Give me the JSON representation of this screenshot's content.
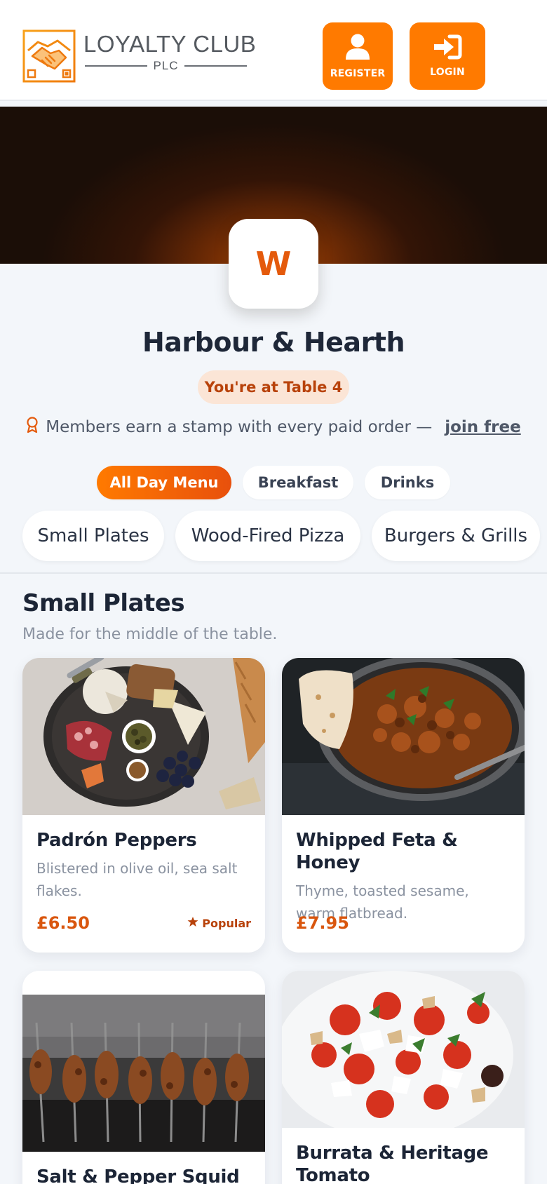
{
  "header": {
    "logo": {
      "title": "LOYALTY CLUB",
      "subtitle": "PLC",
      "icon": "handshake-icon"
    },
    "register_label": "REGISTER",
    "login_label": "LOGIN",
    "accent_color": "#ff7a00"
  },
  "restaurant": {
    "badge_letter": "W",
    "name": "Harbour & Hearth",
    "table_label": "You're at Table 4",
    "member_text": "Members earn a stamp with every paid order —",
    "join_label": "join free"
  },
  "menus": [
    {
      "label": "All Day Menu",
      "active": true
    },
    {
      "label": "Breakfast",
      "active": false
    },
    {
      "label": "Drinks",
      "active": false
    }
  ],
  "categories": [
    "Small Plates",
    "Wood-Fired Pizza",
    "Burgers & Grills"
  ],
  "section": {
    "title": "Small Plates",
    "subtitle": "Made for the middle of the table."
  },
  "items": [
    {
      "name": "Padrón Peppers",
      "description": "Blistered in olive oil, sea salt flakes.",
      "price": "£6.50",
      "badge": "Popular"
    },
    {
      "name": "Whipped Feta & Honey",
      "description": "Thyme, toasted sesame, warm flatbread.",
      "price": "£7.95",
      "badge": ""
    },
    {
      "name": "Salt & Pepper Squid",
      "description": "",
      "price": "",
      "badge": ""
    },
    {
      "name": "Burrata & Heritage Tomato",
      "description": "",
      "price": "",
      "badge": ""
    }
  ]
}
